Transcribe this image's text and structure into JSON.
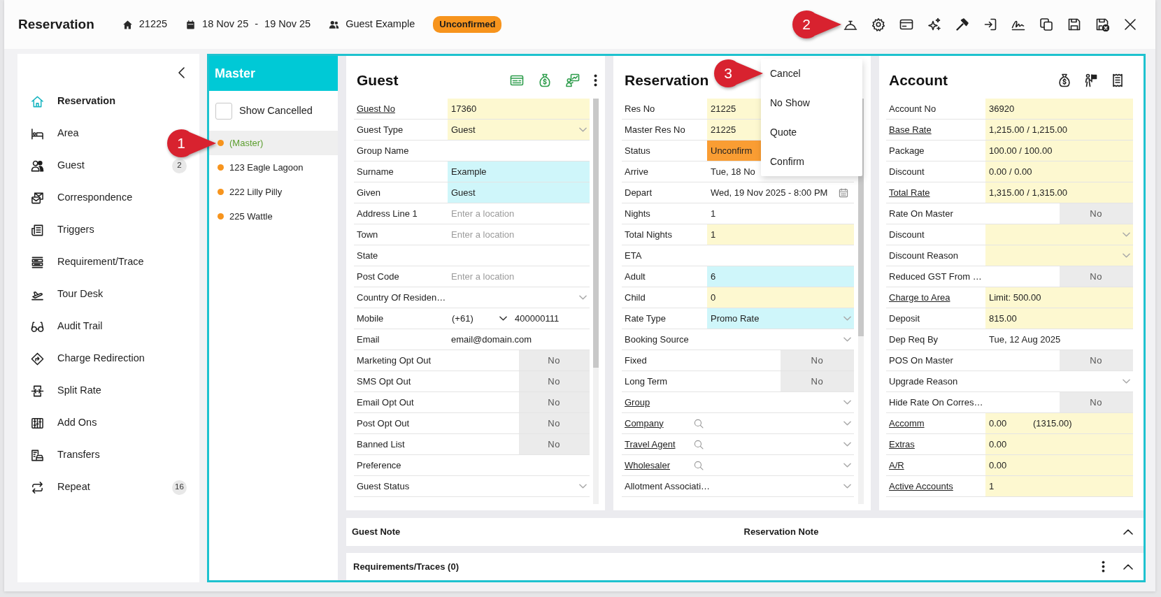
{
  "header": {
    "title": "Reservation",
    "reservation_no": "21225",
    "date_from": "18 Nov 25",
    "date_separator": "-",
    "date_to": "19 Nov 25",
    "guest_name": "Guest Example",
    "status_badge": "Unconfirmed"
  },
  "status_menu": {
    "items": [
      {
        "label": "Cancel"
      },
      {
        "label": "No Show"
      },
      {
        "label": "Quote"
      },
      {
        "label": "Confirm"
      }
    ]
  },
  "sidebar": {
    "items": [
      {
        "label": "Reservation",
        "selected": true
      },
      {
        "label": "Area",
        "selected": false
      },
      {
        "label": "Guest",
        "selected": false,
        "count": "2"
      },
      {
        "label": "Correspondence",
        "selected": false
      },
      {
        "label": "Triggers",
        "selected": false
      },
      {
        "label": "Requirement/Trace",
        "selected": false
      },
      {
        "label": "Tour Desk",
        "selected": false
      },
      {
        "label": "Audit Trail",
        "selected": false
      },
      {
        "label": "Charge Redirection",
        "selected": false
      },
      {
        "label": "Split Rate",
        "selected": false
      },
      {
        "label": "Add Ons",
        "selected": false
      },
      {
        "label": "Transfers",
        "selected": false
      },
      {
        "label": "Repeat",
        "selected": false,
        "count": "16"
      }
    ]
  },
  "master": {
    "title": "Master",
    "show_cancelled": {
      "label": "Show Cancelled",
      "checked": false
    },
    "rooms": [
      {
        "label": "(Master)",
        "selected": true
      },
      {
        "label": "123 Eagle Lagoon",
        "selected": false
      },
      {
        "label": "222 Lilly Pilly",
        "selected": false
      },
      {
        "label": "225 Wattle",
        "selected": false
      }
    ]
  },
  "panels": [
    {
      "title": "Guest",
      "fields": [
        {
          "label": "Guest No",
          "link": true,
          "kind": "text",
          "value": "17360",
          "color": "#fdf8d0"
        },
        {
          "label": "Guest Type",
          "link": false,
          "kind": "select",
          "value": "Guest",
          "color": "#fdf8d0"
        },
        {
          "label": "Group Name",
          "link": false,
          "kind": "text"
        },
        {
          "label": "Surname",
          "link": false,
          "kind": "text",
          "value": "Example",
          "color": "#cff6fa"
        },
        {
          "label": "Given",
          "link": false,
          "kind": "text",
          "value": "Guest",
          "color": "#cff6fa"
        },
        {
          "label": "Address Line 1",
          "link": false,
          "kind": "text",
          "placeholder": "Enter a location"
        },
        {
          "label": "Town",
          "link": false,
          "kind": "text",
          "placeholder": "Enter a location"
        },
        {
          "label": "State",
          "link": false,
          "kind": "text"
        },
        {
          "label": "Post Code",
          "link": false,
          "kind": "text",
          "placeholder": "Enter a location"
        },
        {
          "label": "Country Of Residen…",
          "link": false,
          "kind": "select"
        },
        {
          "label": "Mobile",
          "link": false,
          "kind": "phone",
          "prefix": "(+61)",
          "value": "400000111"
        },
        {
          "label": "Email",
          "link": false,
          "kind": "text",
          "value": "email@domain.com"
        },
        {
          "label": "Marketing Opt Out",
          "link": false,
          "kind": "toggle",
          "value": "No"
        },
        {
          "label": "SMS Opt Out",
          "link": false,
          "kind": "toggle",
          "value": "No"
        },
        {
          "label": "Email Opt Out",
          "link": false,
          "kind": "toggle",
          "value": "No"
        },
        {
          "label": "Post Opt Out",
          "link": false,
          "kind": "toggle",
          "value": "No"
        },
        {
          "label": "Banned List",
          "link": false,
          "kind": "toggle",
          "value": "No"
        },
        {
          "label": "Preference",
          "link": false,
          "kind": "text"
        },
        {
          "label": "Guest Status",
          "link": false,
          "kind": "select"
        }
      ]
    },
    {
      "title": "Reservation",
      "fields": [
        {
          "label": "Res No",
          "link": false,
          "kind": "text",
          "value": "21225",
          "color": "#fdf8d0"
        },
        {
          "label": "Master Res No",
          "link": false,
          "kind": "text",
          "value": "21225",
          "color": "#fdf8d0"
        },
        {
          "label": "Status",
          "link": false,
          "kind": "text",
          "value": "Unconfirm",
          "color": "#fa9d33"
        },
        {
          "label": "Arrive",
          "link": false,
          "kind": "text",
          "value": "Tue, 18 No"
        },
        {
          "label": "Depart",
          "link": false,
          "kind": "date",
          "value": "Wed, 19 Nov 2025 - 8:00 PM"
        },
        {
          "label": "Nights",
          "link": false,
          "kind": "text",
          "value": "1"
        },
        {
          "label": "Total Nights",
          "link": false,
          "kind": "text",
          "value": "1",
          "color": "#fdf8d0"
        },
        {
          "label": "ETA",
          "link": false,
          "kind": "text"
        },
        {
          "label": "Adult",
          "link": false,
          "kind": "text",
          "value": "6",
          "color": "#cff6fa"
        },
        {
          "label": "Child",
          "link": false,
          "kind": "text",
          "value": "0",
          "color": "#fdf8d0"
        },
        {
          "label": "Rate Type",
          "link": false,
          "kind": "select",
          "value": "Promo Rate",
          "color": "#cff6fa"
        },
        {
          "label": "Booking Source",
          "link": false,
          "kind": "select"
        },
        {
          "label": "Fixed",
          "link": false,
          "kind": "toggle",
          "value": "No"
        },
        {
          "label": "Long Term",
          "link": false,
          "kind": "toggle",
          "value": "No"
        },
        {
          "label": "Group",
          "link": true,
          "kind": "select"
        },
        {
          "label": "Company",
          "link": true,
          "kind": "lookup"
        },
        {
          "label": "Travel Agent",
          "link": true,
          "kind": "lookup"
        },
        {
          "label": "Wholesaler",
          "link": true,
          "kind": "lookup"
        },
        {
          "label": "Allotment Associati…",
          "link": false,
          "kind": "select"
        }
      ]
    },
    {
      "title": "Account",
      "fields": [
        {
          "label": "Account No",
          "link": false,
          "kind": "text",
          "value": "36920",
          "color": "#fdf8d0"
        },
        {
          "label": "Base Rate",
          "link": true,
          "kind": "text",
          "value": "1,215.00 / 1,215.00",
          "color": "#fdf8d0"
        },
        {
          "label": "Package",
          "link": false,
          "kind": "text",
          "value": "100.00 / 100.00",
          "color": "#fdf8d0"
        },
        {
          "label": "Discount",
          "link": false,
          "kind": "text",
          "value": "0.00 / 0.00",
          "color": "#fdf8d0"
        },
        {
          "label": "Total Rate",
          "link": true,
          "kind": "text",
          "value": "1,315.00 / 1,315.00",
          "color": "#fdf8d0"
        },
        {
          "label": "Rate On Master",
          "link": false,
          "kind": "toggle",
          "value": "No"
        },
        {
          "label": "Discount",
          "link": false,
          "kind": "select",
          "color": "#fdf8d0"
        },
        {
          "label": "Discount Reason",
          "link": false,
          "kind": "select",
          "color": "#fdf8d0"
        },
        {
          "label": "Reduced GST From …",
          "link": false,
          "kind": "toggle",
          "value": "No"
        },
        {
          "label": "Charge to Area",
          "link": true,
          "kind": "text",
          "value": "Limit: 500.00",
          "color": "#fdf8d0"
        },
        {
          "label": "Deposit",
          "link": false,
          "kind": "text",
          "value": "815.00",
          "color": "#fdf8d0"
        },
        {
          "label": "Dep Req By",
          "link": false,
          "kind": "text",
          "value": "Tue, 12 Aug 2025"
        },
        {
          "label": "POS On Master",
          "link": false,
          "kind": "toggle",
          "value": "No"
        },
        {
          "label": "Upgrade Reason",
          "link": false,
          "kind": "select"
        },
        {
          "label": "Hide Rate On Corres…",
          "link": false,
          "kind": "toggle",
          "value": "No"
        },
        {
          "label": "Accomm",
          "link": true,
          "kind": "text",
          "value": "0.00",
          "value_2": "(1315.00)",
          "color": "#fdf8d0"
        },
        {
          "label": "Extras",
          "link": true,
          "kind": "text",
          "value": "0.00",
          "color": "#fdf8d0"
        },
        {
          "label": "A/R",
          "link": true,
          "kind": "text",
          "value": "0.00",
          "color": "#fdf8d0"
        },
        {
          "label": "Active Accounts",
          "link": true,
          "kind": "text",
          "value": "1",
          "color": "#fdf8d0"
        }
      ]
    }
  ],
  "notes_bar": {
    "items": [
      "Guest Note",
      "Reservation Note"
    ]
  },
  "requirements_bar": {
    "title": "Requirements/Traces (0)"
  },
  "callouts": [
    {
      "label": "1"
    },
    {
      "label": "2"
    },
    {
      "label": "3"
    }
  ]
}
